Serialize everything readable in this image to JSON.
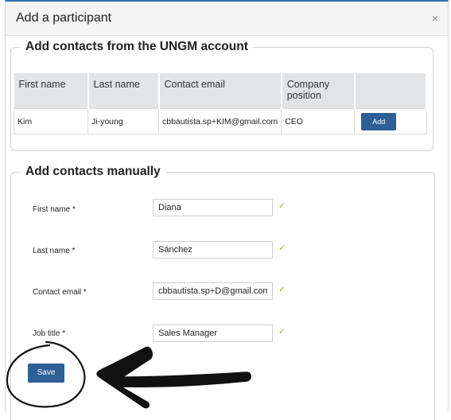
{
  "modal": {
    "title": "Add a participant",
    "close_glyph": "×"
  },
  "ungm_section": {
    "legend": "Add contacts from the UNGM account",
    "headers": [
      "First name",
      "Last name",
      "Contact email",
      "Company position",
      ""
    ],
    "rows": [
      {
        "first_name": "Kim",
        "last_name": "Ji-young",
        "email": "cbbautista.sp+KIM@gmail.com",
        "position": "CEO",
        "action": "Add"
      }
    ]
  },
  "manual_section": {
    "legend": "Add contacts manually",
    "fields": [
      {
        "label": "First name *",
        "value": "Diana"
      },
      {
        "label": "Last name *",
        "value": "Sánchez"
      },
      {
        "label": "Contact email *",
        "value": "cbbautista.sp+D@gmail.com"
      },
      {
        "label": "Job title *",
        "value": "Sales Manager"
      }
    ],
    "check_glyph": "✓",
    "save_label": "Save"
  },
  "colors": {
    "primary": "#2e5e96",
    "check": "#8bbf3a",
    "header_bg": "#f4f4f4"
  },
  "annotation": {
    "circle": "hand-drawn circle around Save",
    "arrow": "hand-drawn arrow pointing to Save"
  }
}
